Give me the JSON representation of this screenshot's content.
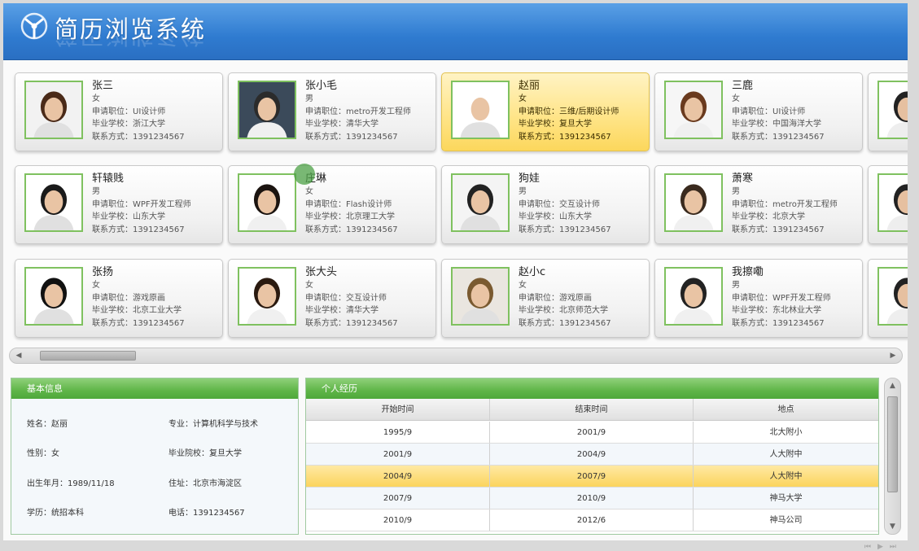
{
  "app": {
    "title": "简历浏览系统"
  },
  "colors": {
    "header": "#2f7bd0",
    "accent_green": "#5fb548",
    "selected": "#fbd45d"
  },
  "labels": {
    "position": "申请职位：",
    "school": "毕业学校：",
    "contact": "联系方式："
  },
  "cards": [
    {
      "name": "张三",
      "gender": "女",
      "position": "UI设计师",
      "school": "浙江大学",
      "phone": "1391234567",
      "selected": false
    },
    {
      "name": "张小毛",
      "gender": "男",
      "position": "metro开发工程师",
      "school": "清华大学",
      "phone": "1391234567",
      "selected": false
    },
    {
      "name": "赵丽",
      "gender": "女",
      "position": "三维/后期设计师",
      "school": "复旦大学",
      "phone": "1391234567",
      "selected": true
    },
    {
      "name": "三鹿",
      "gender": "女",
      "position": "UI设计师",
      "school": "中国海洋大学",
      "phone": "1391234567",
      "selected": false
    },
    {
      "name": "轩辕贱",
      "gender": "男",
      "position": "WPF开发工程师",
      "school": "山东大学",
      "phone": "1391234567",
      "selected": false
    },
    {
      "name": "庄琳",
      "gender": "女",
      "position": "Flash设计师",
      "school": "北京理工大学",
      "phone": "1391234567",
      "selected": false
    },
    {
      "name": "狗娃",
      "gender": "男",
      "position": "交互设计师",
      "school": "山东大学",
      "phone": "1391234567",
      "selected": false
    },
    {
      "name": "萧寒",
      "gender": "男",
      "position": "metro开发工程师",
      "school": "北京大学",
      "phone": "1391234567",
      "selected": false
    },
    {
      "name": "张扬",
      "gender": "女",
      "position": "游戏原画",
      "school": "北京工业大学",
      "phone": "1391234567",
      "selected": false
    },
    {
      "name": "张大头",
      "gender": "女",
      "position": "交互设计师",
      "school": "清华大学",
      "phone": "1391234567",
      "selected": false
    },
    {
      "name": "赵小c",
      "gender": "女",
      "position": "游戏原画",
      "school": "北京师范大学",
      "phone": "1391234567",
      "selected": false
    },
    {
      "name": "我擦嘞",
      "gender": "男",
      "position": "WPF开发工程师",
      "school": "东北林业大学",
      "phone": "1391234567",
      "selected": false
    }
  ],
  "basic_info": {
    "title": "基本信息",
    "name": "姓名：赵丽",
    "major": "专业：计算机科学与技术",
    "gender": "性别：女",
    "college": "毕业院校：复旦大学",
    "birth": "出生年月：1989/11/18",
    "address": "住址：北京市海淀区",
    "education": "学历：统招本科",
    "phone": "电话：1391234567"
  },
  "history": {
    "title": "个人经历",
    "columns": [
      "开始时间",
      "结束时间",
      "地点"
    ],
    "rows": [
      [
        "1995/9",
        "2001/9",
        "北大附小"
      ],
      [
        "2001/9",
        "2004/9",
        "人大附中"
      ],
      [
        "2004/9",
        "2007/9",
        "人大附中"
      ],
      [
        "2007/9",
        "2010/9",
        "神马大学"
      ],
      [
        "2010/9",
        "2012/6",
        "神马公司"
      ]
    ],
    "selected_row": 2
  }
}
